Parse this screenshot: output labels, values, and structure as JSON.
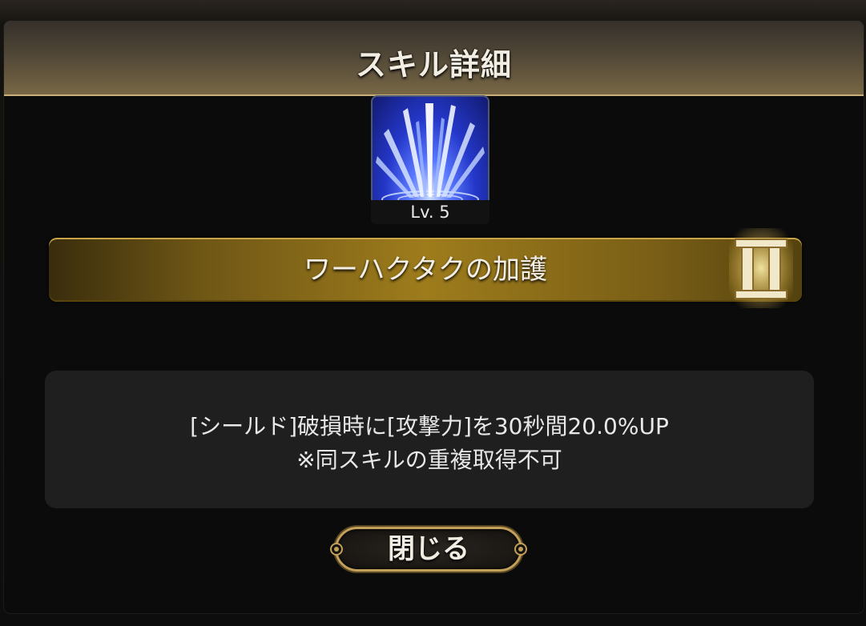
{
  "dialog": {
    "title": "スキル詳細",
    "skill": {
      "icon": "burst-shards-icon",
      "level_label": "Lv. 5",
      "name": "ワーハクタクの加護",
      "rank_numeral": "II",
      "rank_icon": "roman-numeral-two-emblem"
    },
    "description": {
      "line1": "[シールド]破損時に[攻撃力]を30秒間20.0%UP",
      "line2": "※同スキルの重複取得不可"
    },
    "close_label": "閉じる"
  },
  "colors": {
    "header_gold": "#786745",
    "name_bar_gold": "#9e7c1c",
    "emblem_cream": "#f1e7c9",
    "icon_blue": "#2437c9",
    "button_border": "#c2a059"
  }
}
